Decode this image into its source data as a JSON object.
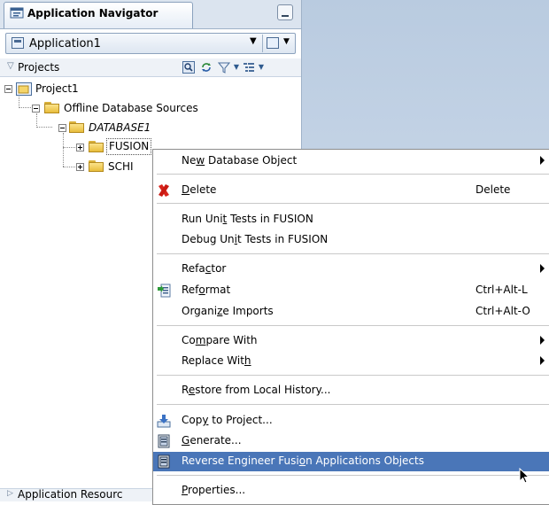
{
  "navigator": {
    "tab_title": "Application Navigator",
    "application_selector": {
      "value": "Application1"
    },
    "projects_label": "Projects",
    "tree": {
      "project": "Project1",
      "offline_sources": "Offline Database Sources",
      "database": "DATABASE1",
      "fusion": "FUSION",
      "schema": "SCHI"
    },
    "bottom_panel": "Application Resourc"
  },
  "context_menu": {
    "items": [
      {
        "id": "new-db-object",
        "pre": "Ne",
        "u": "w",
        "post": " Database Object",
        "accel": "",
        "submenu": true
      },
      {
        "id": "delete",
        "pre": "",
        "u": "D",
        "post": "elete",
        "accel": "Delete",
        "submenu": false,
        "icon": "red-x-icon"
      },
      {
        "id": "run-unit-tests",
        "pre": "Run Uni",
        "u": "t",
        "post": " Tests in FUSION",
        "accel": "",
        "submenu": false
      },
      {
        "id": "debug-unit-tests",
        "pre": "Debug Un",
        "u": "i",
        "post": "t Tests in FUSION",
        "accel": "",
        "submenu": false
      },
      {
        "id": "refactor",
        "pre": "Refa",
        "u": "c",
        "post": "tor",
        "accel": "",
        "submenu": true
      },
      {
        "id": "reformat",
        "pre": "Ref",
        "u": "o",
        "post": "rmat",
        "accel": "Ctrl+Alt-L",
        "submenu": false,
        "icon": "reformat-icon"
      },
      {
        "id": "organize-imports",
        "pre": "Organi",
        "u": "z",
        "post": "e Imports",
        "accel": "Ctrl+Alt-O",
        "submenu": false
      },
      {
        "id": "compare-with",
        "pre": "Co",
        "u": "m",
        "post": "pare With",
        "accel": "",
        "submenu": true
      },
      {
        "id": "replace-with",
        "pre": "Replace Wit",
        "u": "h",
        "post": "",
        "accel": "",
        "submenu": true
      },
      {
        "id": "restore-history",
        "pre": "R",
        "u": "e",
        "post": "store from Local History...",
        "accel": "",
        "submenu": false
      },
      {
        "id": "copy-to-project",
        "pre": "Cop",
        "u": "y",
        "post": " to Project...",
        "accel": "",
        "submenu": false,
        "icon": "copy-down-icon"
      },
      {
        "id": "generate",
        "pre": "",
        "u": "G",
        "post": "enerate...",
        "accel": "",
        "submenu": false,
        "icon": "generate-icon"
      },
      {
        "id": "reverse-engineer",
        "pre": "Reverse Engineer Fusi",
        "u": "o",
        "post": "n Applications Objects",
        "accel": "",
        "submenu": false,
        "icon": "generate-icon",
        "highlighted": true
      },
      {
        "id": "properties",
        "pre": "",
        "u": "P",
        "post": "roperties...",
        "accel": "",
        "submenu": false
      }
    ]
  },
  "colors": {
    "highlight": "#4a76b8",
    "background_gradient": "#c9d7e8"
  }
}
